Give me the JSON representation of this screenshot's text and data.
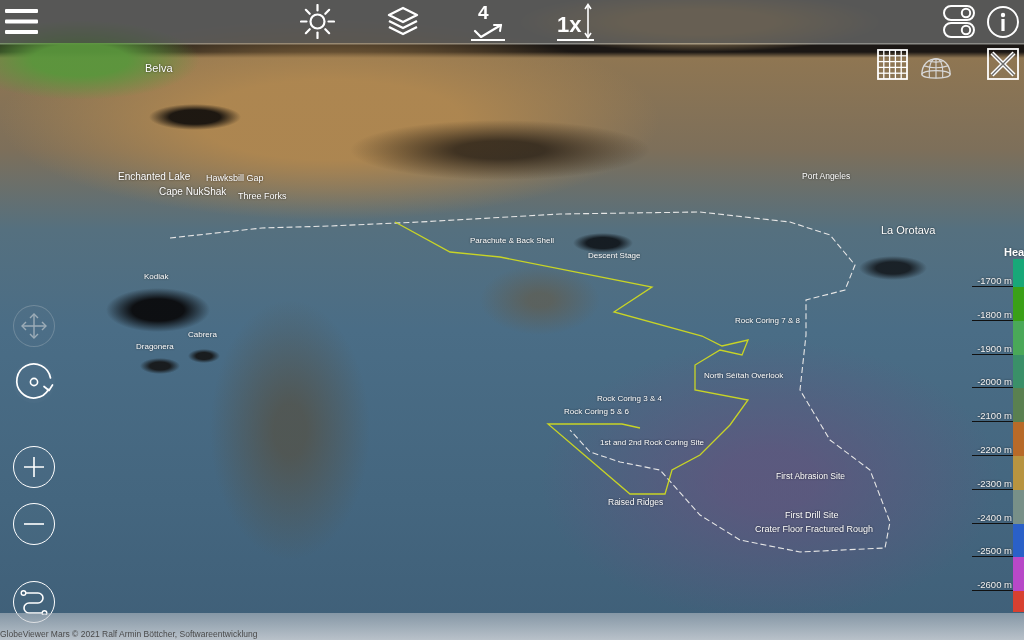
{
  "toolbar": {
    "left": [
      {
        "kind": "menu"
      }
    ],
    "center": [
      {
        "kind": "lighting"
      },
      {
        "kind": "layers"
      },
      {
        "kind": "markers",
        "text": "4"
      },
      {
        "kind": "exaggeration",
        "text": "1x"
      }
    ],
    "right": [
      {
        "kind": "toggles"
      },
      {
        "kind": "info"
      }
    ]
  },
  "view_buttons": [
    {
      "kind": "grid"
    },
    {
      "kind": "globe"
    },
    {
      "kind": "close"
    }
  ],
  "map_labels": [
    "Belva",
    "Enchanted Lake",
    "Cape NukShak",
    "Hawksbill Gap",
    "Three Forks",
    "Port Angeles",
    "La Orotava",
    "Parachute & Back Shell",
    "Descent Stage",
    "Kodiak",
    "Cabrera",
    "Dragonera",
    "Rock Coring 7 & 8",
    "North Séítah Overlook",
    "Rock Coring 3 & 4",
    "Rock Coring 5 & 6",
    "1st and 2nd Rock Coring Site",
    "Raised Ridges",
    "First Abrasion Site",
    "First Drill Site",
    "Crater Floor Fractured Rough"
  ],
  "nav_controls": [
    {
      "kind": "pan",
      "disabled": true
    },
    {
      "kind": "rotate",
      "disabled": false
    },
    {
      "kind": "zoom_in",
      "disabled": false
    },
    {
      "kind": "zoom_out",
      "disabled": false
    },
    {
      "kind": "route",
      "disabled": false
    }
  ],
  "legend": {
    "title": "Hea",
    "ticks": [
      "-1700 m",
      "-1800 m",
      "-1900 m",
      "-2000 m",
      "-2100 m",
      "-2200 m",
      "-2300 m",
      "-2400 m",
      "-2500 m",
      "-2600 m"
    ],
    "bands": [
      {
        "color": "#18a878"
      },
      {
        "color": "#3aa018"
      },
      {
        "color": "#4aa858"
      },
      {
        "color": "#3a9068"
      },
      {
        "color": "#5a8050"
      },
      {
        "color": "#b86a28"
      },
      {
        "color": "#b89440"
      },
      {
        "color": "#789088"
      },
      {
        "color": "#2a60c8"
      },
      {
        "color": "#b848c8"
      },
      {
        "color": "#d84030"
      }
    ]
  },
  "footer": {
    "text": "GlobeViewer Mars © 2021 Ralf Armin Böttcher, Softwareentwicklung"
  }
}
